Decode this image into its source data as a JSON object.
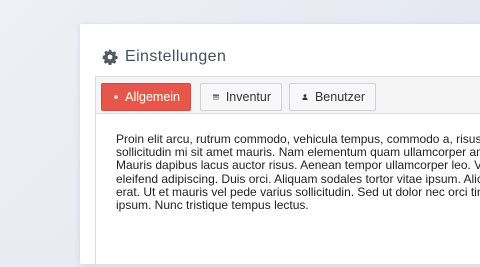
{
  "panel": {
    "title": "Einstellungen",
    "title_icon": "gear-icon"
  },
  "tabs": [
    {
      "label": "Allgemein",
      "icon": "gear-icon",
      "active": true
    },
    {
      "label": "Inventur",
      "icon": "list-window-icon",
      "active": false
    },
    {
      "label": "Benutzer",
      "icon": "user-icon",
      "active": false
    }
  ],
  "content": {
    "lines": [
      "Proin elit arcu, rutrum commodo, vehicula tempus, commodo a, risus",
      "sollicitudin mi sit amet mauris. Nam elementum quam ullamcorper an",
      "Mauris dapibus lacus auctor risus. Aenean tempor ullamcorper leo. V",
      "eleifend adipiscing. Duis orci. Aliquam sodales tortor vitae ipsum. Alic",
      "erat. Ut et mauris vel pede varius sollicitudin. Sed ut dolor nec orci tin",
      "ipsum. Nunc tristique tempus lectus."
    ]
  },
  "colors": {
    "active_tab": "#e4574a",
    "background": "#e8ebf2",
    "panel": "#ffffff"
  }
}
